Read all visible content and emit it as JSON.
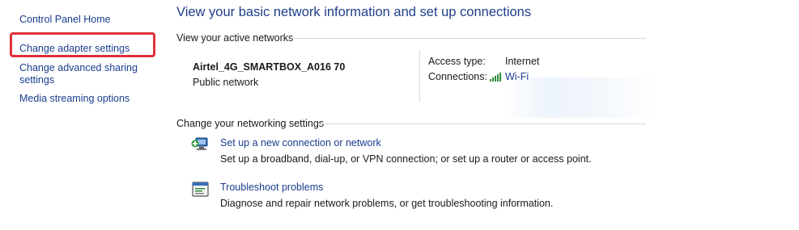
{
  "sidebar": {
    "home": "Control Panel Home",
    "items": [
      {
        "label": "Change adapter settings"
      },
      {
        "label_line1": "Change advanced sharing",
        "label_line2": "settings"
      },
      {
        "label": "Media streaming options"
      }
    ]
  },
  "main": {
    "title": "View your basic network information and set up connections",
    "active_networks_heading": "View your active networks",
    "network": {
      "name": "Airtel_4G_SMARTBOX_A016 70",
      "type": "Public network",
      "access_type_label": "Access type:",
      "access_type_value": "Internet",
      "connections_label": "Connections:",
      "connections_value": "Wi-Fi"
    },
    "settings_heading": "Change your networking settings",
    "tasks": [
      {
        "link": "Set up a new connection or network",
        "desc": "Set up a broadband, dial-up, or VPN connection; or set up a router or access point.",
        "icon": "new-connection-icon"
      },
      {
        "link": "Troubleshoot problems",
        "desc": "Diagnose and repair network problems, or get troubleshooting information.",
        "icon": "troubleshoot-icon"
      }
    ]
  },
  "colors": {
    "link": "#1a3d8f",
    "title": "#1e3f8a",
    "highlight": "#e0313b",
    "wifi": "#2e8b3a"
  }
}
